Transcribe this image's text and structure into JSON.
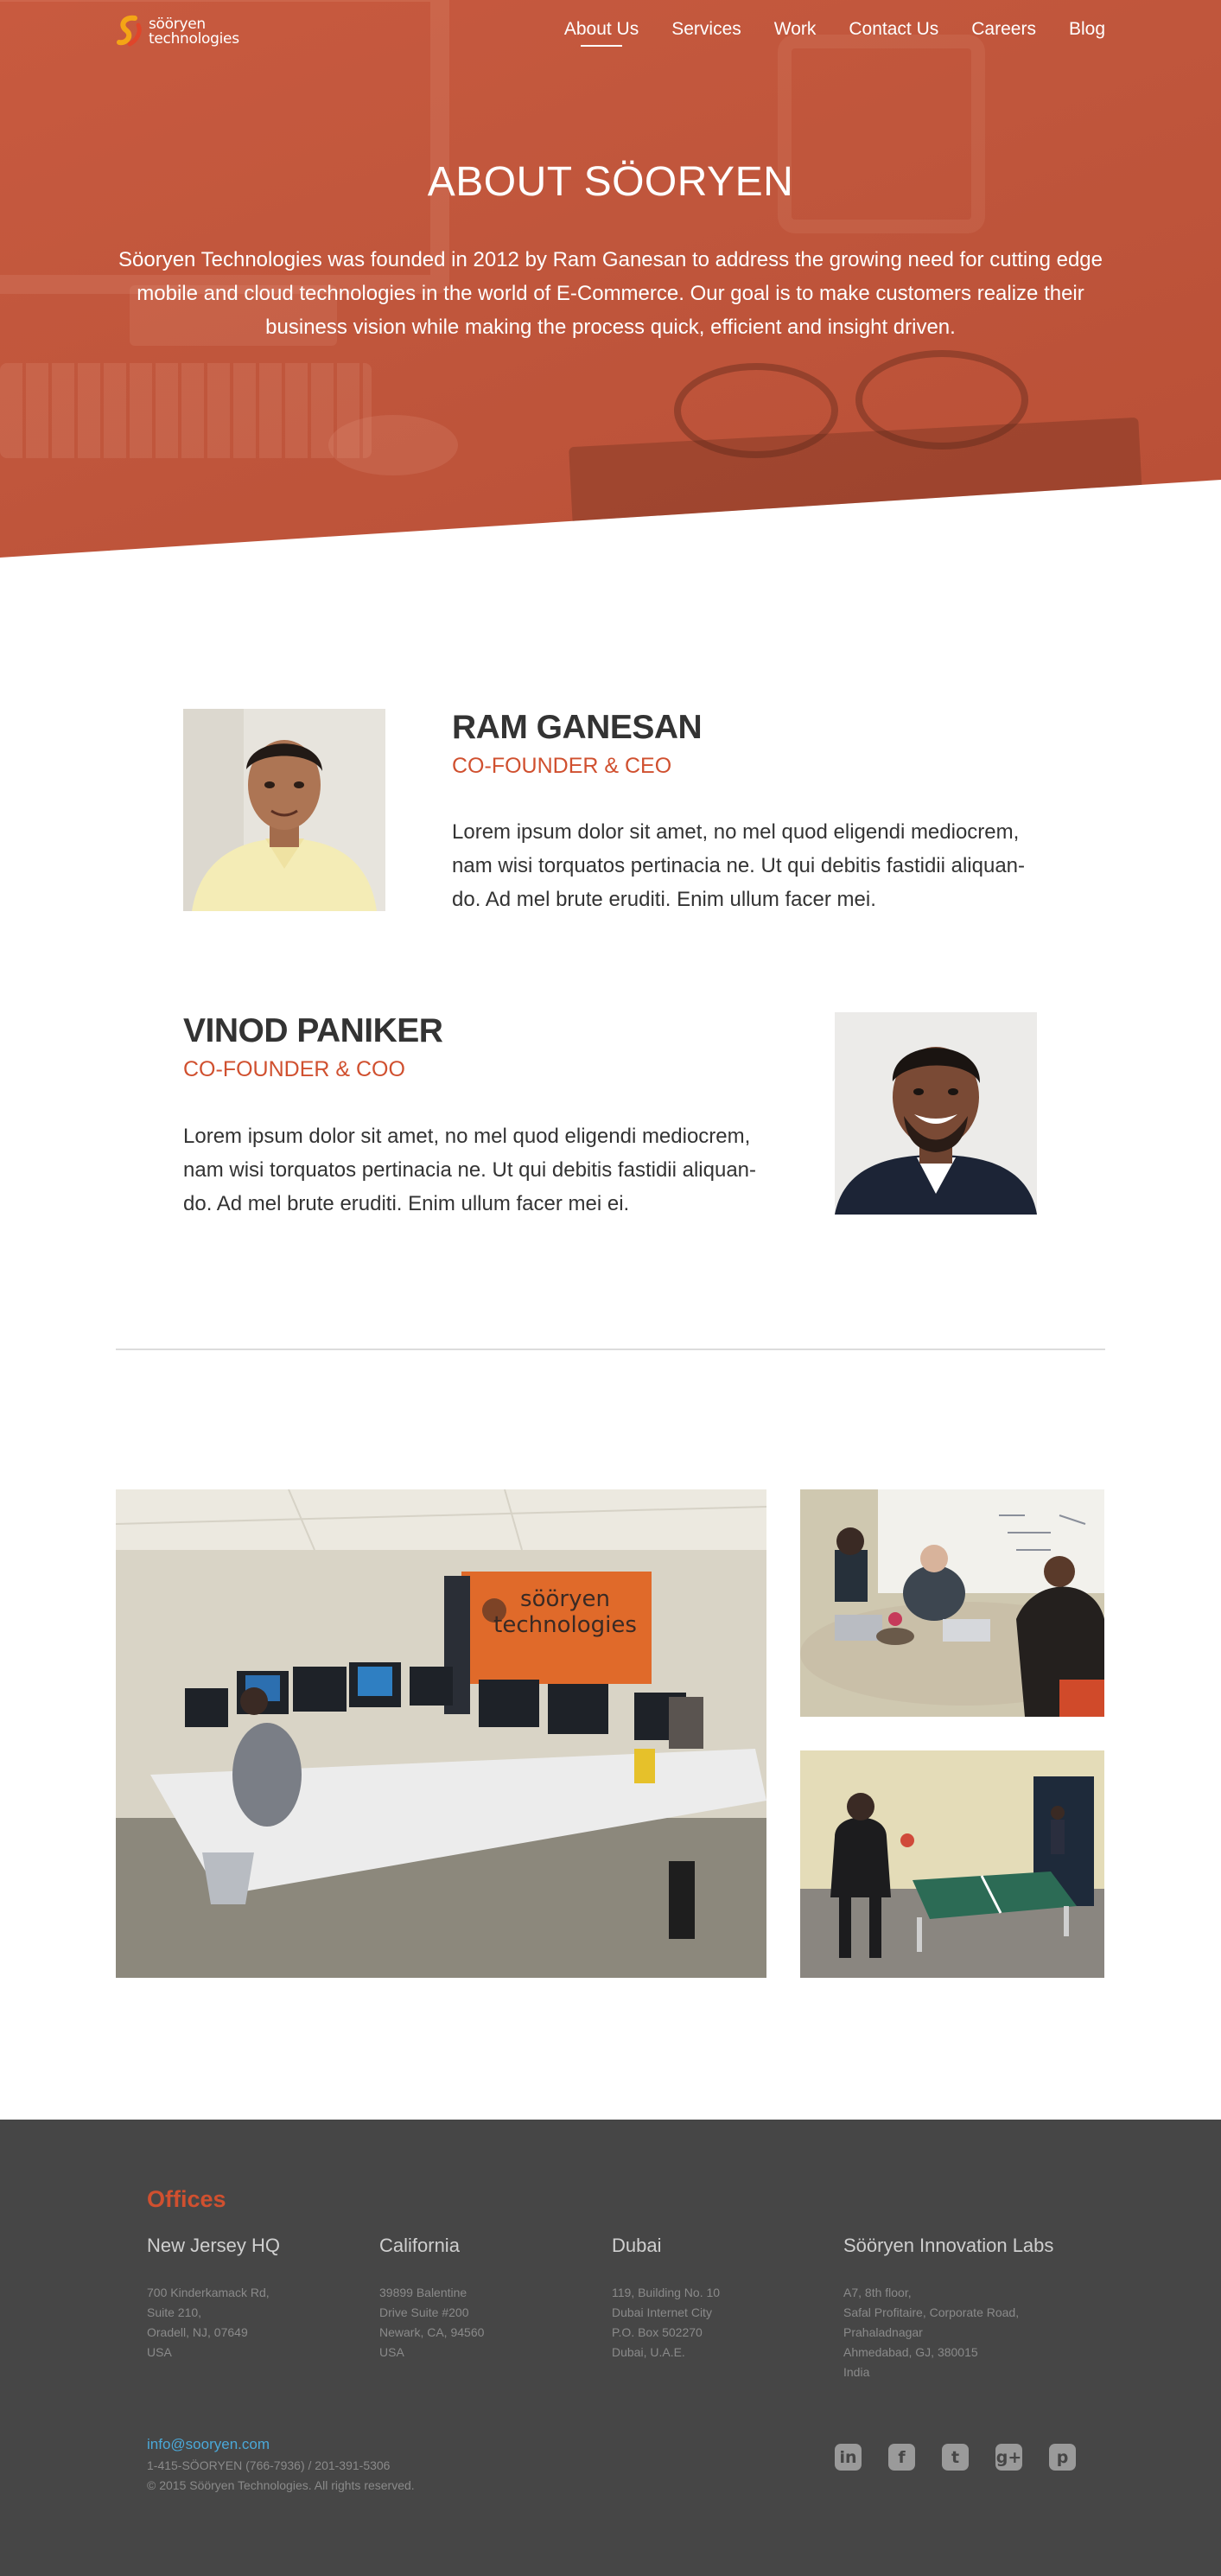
{
  "brand": {
    "logo_line1": "sööryen",
    "logo_line2": "technologies",
    "accent": "#d0502f"
  },
  "nav": {
    "items": [
      {
        "label": "About Us",
        "active": true
      },
      {
        "label": "Services"
      },
      {
        "label": "Work"
      },
      {
        "label": "Contact Us"
      },
      {
        "label": "Careers"
      },
      {
        "label": "Blog"
      }
    ]
  },
  "hero": {
    "title": "ABOUT SÖORYEN",
    "text": "Söoryen Technologies was founded in 2012 by Ram Ganesan to address the growing need for cutting edge mobile and cloud technologies in the world of E-Commerce. Our goal is to make customers realize their business vision while making the process quick, efficient and insight driven."
  },
  "team": [
    {
      "name": "RAM GANESAN",
      "role": "CO-FOUNDER & CEO",
      "bio": "Lorem ipsum dolor sit amet, no mel quod eligendi mediocrem, nam wisi torquatos pertinacia ne. Ut qui debitis fastidii aliquan-do. Ad mel brute eruditi. Enim ullum facer mei."
    },
    {
      "name": "VINOD PANIKER",
      "role": "CO-FOUNDER & COO",
      "bio": "Lorem ipsum dolor sit amet, no mel quod eligendi mediocrem, nam wisi torquatos pertinacia ne. Ut qui debitis fastidii aliquan-do. Ad mel brute eruditi. Enim ullum facer mei ei."
    }
  ],
  "gallery": {
    "wall_logo_line1": "sööryen",
    "wall_logo_line2": "technologies"
  },
  "footer": {
    "heading": "Offices",
    "offices": [
      {
        "name": "New Jersey HQ",
        "lines": [
          "700 Kinderkamack Rd,",
          "Suite 210,",
          "Oradell, NJ, 07649",
          "USA"
        ]
      },
      {
        "name": "California",
        "lines": [
          "39899 Balentine",
          "Drive Suite #200",
          "Newark, CA, 94560",
          "USA"
        ]
      },
      {
        "name": "Dubai",
        "lines": [
          "119, Building No. 10",
          "Dubai Internet City",
          "P.O. Box 502270",
          "Dubai, U.A.E."
        ]
      },
      {
        "name": "Sööryen Innovation Labs",
        "lines": [
          "A7, 8th floor,",
          "Safal Profitaire, Corporate Road,",
          "Prahaladnagar",
          "Ahmedabad, GJ, 380015",
          "India"
        ]
      }
    ],
    "email": "info@sooryen.com",
    "phone": "1-415-SÖORYEN (766-7936) / 201-391-5306",
    "copyright": "© 2015 Sööryen Technologies. All rights reserved.",
    "socials": [
      {
        "icon": "linkedin-icon",
        "glyph": "in"
      },
      {
        "icon": "facebook-icon",
        "glyph": "f"
      },
      {
        "icon": "twitter-icon",
        "glyph": "t"
      },
      {
        "icon": "google-plus-icon",
        "glyph": "g+"
      },
      {
        "icon": "pinterest-icon",
        "glyph": "p"
      }
    ]
  }
}
